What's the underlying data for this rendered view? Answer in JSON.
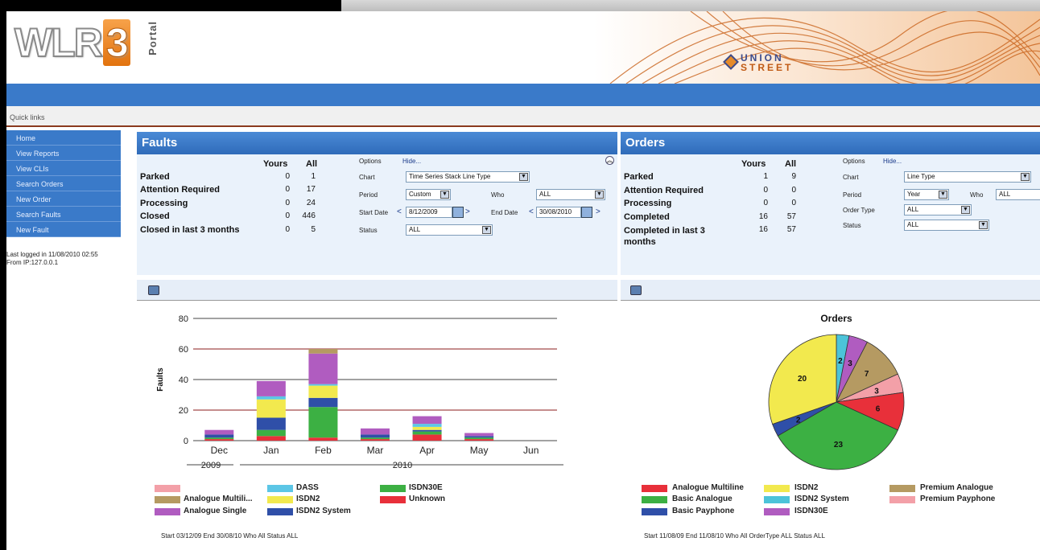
{
  "header": {
    "logo_text": "WLR",
    "logo_number": "3",
    "logo_sub": "Portal",
    "partner": "UNION",
    "partner_sub": "STREET"
  },
  "quicklinks": {
    "label": "Quick links"
  },
  "sidebar": {
    "items": [
      {
        "label": "Home"
      },
      {
        "label": "View Reports"
      },
      {
        "label": "View CLIs"
      },
      {
        "label": "Search Orders"
      },
      {
        "label": "New Order"
      },
      {
        "label": "Search Faults"
      },
      {
        "label": "New Fault"
      }
    ]
  },
  "session": {
    "line1": "Last logged in 11/08/2010 02:55",
    "line2": "From IP:127.0.0.1"
  },
  "faults": {
    "title": "Faults",
    "col_yours": "Yours",
    "col_all": "All",
    "rows": [
      {
        "label": "Parked",
        "yours": "0",
        "all": "1"
      },
      {
        "label": "Attention Required",
        "yours": "0",
        "all": "17"
      },
      {
        "label": "Processing",
        "yours": "0",
        "all": "24"
      },
      {
        "label": "Closed",
        "yours": "0",
        "all": "446"
      },
      {
        "label": "Closed in last 3 months",
        "yours": "0",
        "all": "5"
      }
    ],
    "options_label": "Options",
    "hide_label": "Hide...",
    "chart_label": "Chart",
    "chart_value": "Time Series Stack Line Type",
    "period_label": "Period",
    "period_value": "Custom",
    "who_label": "Who",
    "who_value": "ALL",
    "start_label": "Start Date",
    "start_value": "8/12/2009",
    "end_label": "End Date",
    "end_value": "30/08/2010",
    "status_label": "Status",
    "status_value": "ALL",
    "footer": "Start 03/12/09 End 30/08/10 Who All Status ALL"
  },
  "orders": {
    "title": "Orders",
    "col_yours": "Yours",
    "col_all": "All",
    "rows": [
      {
        "label": "Parked",
        "yours": "1",
        "all": "9"
      },
      {
        "label": "Attention Required",
        "yours": "0",
        "all": "0"
      },
      {
        "label": "Processing",
        "yours": "0",
        "all": "0"
      },
      {
        "label": "Completed",
        "yours": "16",
        "all": "57"
      },
      {
        "label": "Completed in last 3 months",
        "yours": "16",
        "all": "57"
      }
    ],
    "options_label": "Options",
    "hide_label": "Hide...",
    "chart_label": "Chart",
    "chart_value": "Line Type",
    "period_label": "Period",
    "period_value": "Year",
    "who_label": "Who",
    "who_value": "ALL",
    "ordertype_label": "Order Type",
    "ordertype_value": "ALL",
    "status_label": "Status",
    "status_value": "ALL",
    "footer": "Start 11/08/09 End 11/08/10 Who All OrderType ALL Status ALL"
  },
  "colors": {
    "blue": "#3a7ac9",
    "analogue_multiline": "#e8303a",
    "basic_analogue": "#3cb043",
    "basic_payphone": "#2f4fa8",
    "isdn2": "#f2e94e",
    "isdn2_system": "#4cc3d9",
    "isdn30e": "#b05cc0",
    "premium_analogue": "#b59a62",
    "premium_payphone": "#f3a0a8",
    "unknown": "#e8303a",
    "dass": "#5cc6e6",
    "analogue_single": "#b05cc0"
  },
  "chart_data": [
    {
      "type": "bar",
      "title": "",
      "ylabel": "Faults",
      "xlabel": "",
      "ylim": [
        0,
        80
      ],
      "yticks": [
        "0",
        "20",
        "40",
        "60",
        "80"
      ],
      "categories": [
        "Dec",
        "Jan",
        "Feb",
        "Mar",
        "Apr",
        "May",
        "Jun"
      ],
      "year_labels": [
        "2009",
        "2010"
      ],
      "series": [
        {
          "name": "Unknown",
          "color": "#e8303a",
          "values": [
            1,
            3,
            2,
            1,
            4,
            1,
            0
          ]
        },
        {
          "name": "ISDN30E",
          "color": "#3cb043",
          "values": [
            1,
            4,
            20,
            1,
            2,
            1,
            0
          ]
        },
        {
          "name": "ISDN2 System",
          "color": "#2f4fa8",
          "values": [
            2,
            8,
            6,
            2,
            1,
            1,
            0
          ]
        },
        {
          "name": "ISDN2",
          "color": "#f2e94e",
          "values": [
            0,
            12,
            8,
            0,
            2,
            0,
            0
          ]
        },
        {
          "name": "DASS",
          "color": "#5cc6e6",
          "values": [
            0,
            2,
            1,
            0,
            2,
            0,
            0
          ]
        },
        {
          "name": "Analogue Single",
          "color": "#b05cc0",
          "values": [
            3,
            10,
            20,
            4,
            5,
            2,
            0
          ]
        },
        {
          "name": "Analogue Multili...",
          "color": "#b59a62",
          "values": [
            0,
            0,
            3,
            0,
            0,
            0,
            0
          ]
        },
        {
          "name": "",
          "color": "#f3a0a8",
          "values": [
            0,
            0,
            0,
            0,
            0,
            0,
            0
          ]
        }
      ],
      "grid": true
    },
    {
      "type": "pie",
      "title": "Orders",
      "slices": [
        {
          "name": "Analogue Multiline",
          "value": 6,
          "color": "#e8303a"
        },
        {
          "name": "Basic Analogue",
          "value": 23,
          "color": "#3cb043"
        },
        {
          "name": "Basic Payphone",
          "value": 2,
          "color": "#2f4fa8"
        },
        {
          "name": "ISDN2",
          "value": 20,
          "color": "#f2e94e"
        },
        {
          "name": "ISDN2 System",
          "value": 2,
          "color": "#4cc3d9"
        },
        {
          "name": "ISDN30E",
          "value": 3,
          "color": "#b05cc0"
        },
        {
          "name": "Premium Analogue",
          "value": 7,
          "color": "#b59a62"
        },
        {
          "name": "Premium Payphone",
          "value": 3,
          "color": "#f3a0a8"
        }
      ]
    }
  ]
}
